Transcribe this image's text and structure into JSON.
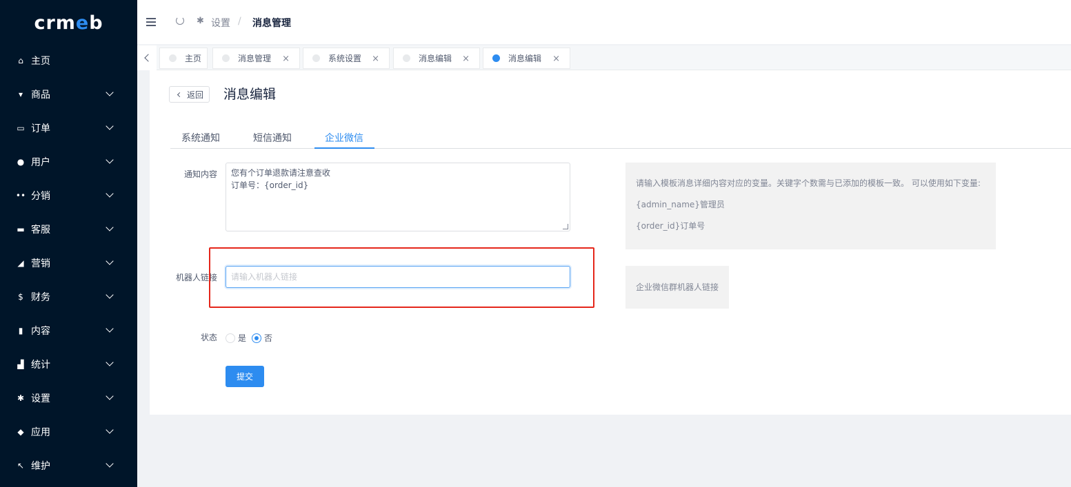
{
  "brand": {
    "logo_text_pre": "crm",
    "logo_text_e": "e",
    "logo_text_post": "b",
    "accent_color": "#2d8cf0",
    "sidebar_bg": "#001529",
    "highlight_color": "#e5261a"
  },
  "sidebar": {
    "items": [
      {
        "label": "主页",
        "icon": "home-icon",
        "has_arrow": false
      },
      {
        "label": "商品",
        "icon": "shopping-basket-icon",
        "has_arrow": true
      },
      {
        "label": "订单",
        "icon": "cart-icon",
        "has_arrow": true
      },
      {
        "label": "用户",
        "icon": "user-icon",
        "has_arrow": true
      },
      {
        "label": "分销",
        "icon": "users-group-icon",
        "has_arrow": true
      },
      {
        "label": "客服",
        "icon": "chat-icon",
        "has_arrow": true
      },
      {
        "label": "营销",
        "icon": "send-icon",
        "has_arrow": true
      },
      {
        "label": "财务",
        "icon": "dollar-icon",
        "has_arrow": true
      },
      {
        "label": "内容",
        "icon": "book-icon",
        "has_arrow": true
      },
      {
        "label": "统计",
        "icon": "bar-chart-icon",
        "has_arrow": true
      },
      {
        "label": "设置",
        "icon": "gear-icon",
        "has_arrow": true
      },
      {
        "label": "应用",
        "icon": "cube-icon",
        "has_arrow": true
      },
      {
        "label": "维护",
        "icon": "hammer-icon",
        "has_arrow": true
      }
    ]
  },
  "header": {
    "breadcrumb": {
      "parent": "设置",
      "separator": "/",
      "current": "消息管理"
    }
  },
  "tabs": [
    {
      "label": "主页",
      "closable": false,
      "active": false
    },
    {
      "label": "消息管理",
      "closable": true,
      "active": false
    },
    {
      "label": "系统设置",
      "closable": true,
      "active": false
    },
    {
      "label": "消息编辑",
      "closable": true,
      "active": false
    },
    {
      "label": "消息编辑",
      "closable": true,
      "active": true
    }
  ],
  "tab_close_glyph": "×",
  "page": {
    "back_label": "返回",
    "title": "消息编辑",
    "content_tabs": [
      "系统通知",
      "短信通知",
      "企业微信"
    ],
    "active_content_tab": "企业微信"
  },
  "form": {
    "content_label": "通知内容",
    "content_value": "您有个订单退款请注意查收\n订单号：{order_id}",
    "help_lines": [
      "请输入模板消息详细内容对应的变量。关键字个数需与已添加的模板一致。 可以使用如下变量:",
      "{admin_name}管理员",
      "{order_id}订单号"
    ],
    "robot_label": "机器人链接",
    "robot_placeholder": "请输入机器人链接",
    "robot_value": "",
    "robot_help": "企业微信群机器人链接",
    "status_label": "状态",
    "status_options": [
      "是",
      "否"
    ],
    "status_selected": "否",
    "submit_label": "提交"
  }
}
